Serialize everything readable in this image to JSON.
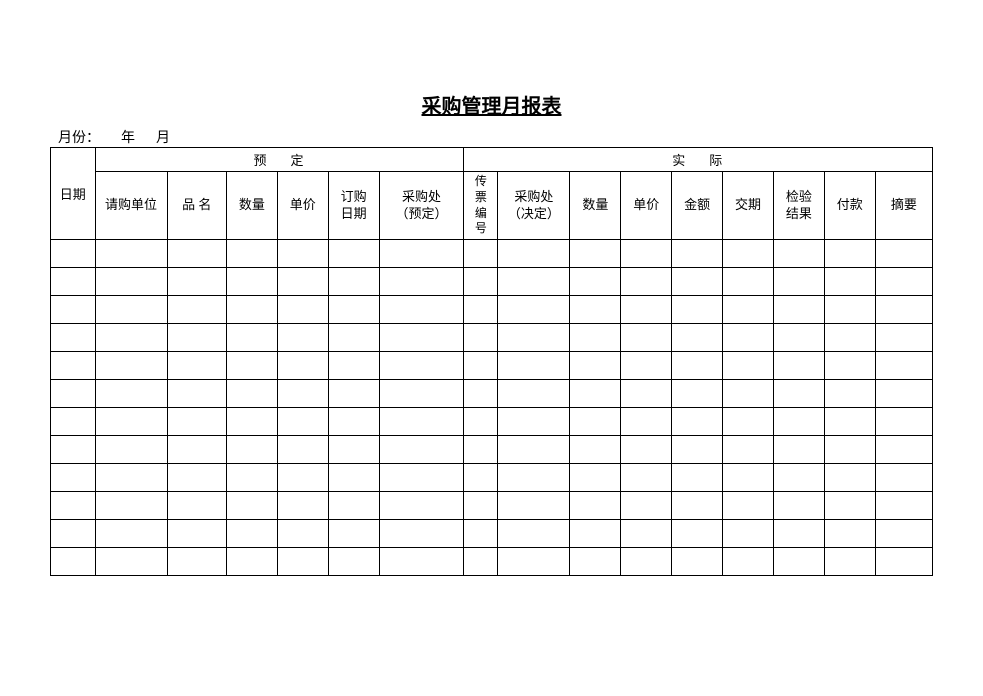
{
  "title": "采购管理月报表",
  "month_label_prefix": "月份：",
  "month_year_char": "年",
  "month_month_char": "月",
  "headers": {
    "date": "日期",
    "group_plan": "预定",
    "group_actual": "实际",
    "request_unit": "请购单位",
    "item_name": "品 名",
    "quantity": "数量",
    "unit_price": "单价",
    "order_date": "订购\n日期",
    "purchase_plan": "采购处\n（预定）",
    "ticket_no": "传\n票\n编\n号",
    "purchase_decide": "采购处\n（决定）",
    "quantity2": "数量",
    "unit_price2": "单价",
    "amount": "金额",
    "delivery": "交期",
    "inspection": "检验\n结果",
    "payment": "付款",
    "summary": "摘要"
  },
  "rows": [
    [
      "",
      "",
      "",
      "",
      "",
      "",
      "",
      "",
      "",
      "",
      "",
      "",
      "",
      "",
      "",
      ""
    ],
    [
      "",
      "",
      "",
      "",
      "",
      "",
      "",
      "",
      "",
      "",
      "",
      "",
      "",
      "",
      "",
      ""
    ],
    [
      "",
      "",
      "",
      "",
      "",
      "",
      "",
      "",
      "",
      "",
      "",
      "",
      "",
      "",
      "",
      ""
    ],
    [
      "",
      "",
      "",
      "",
      "",
      "",
      "",
      "",
      "",
      "",
      "",
      "",
      "",
      "",
      "",
      ""
    ],
    [
      "",
      "",
      "",
      "",
      "",
      "",
      "",
      "",
      "",
      "",
      "",
      "",
      "",
      "",
      "",
      ""
    ],
    [
      "",
      "",
      "",
      "",
      "",
      "",
      "",
      "",
      "",
      "",
      "",
      "",
      "",
      "",
      "",
      ""
    ],
    [
      "",
      "",
      "",
      "",
      "",
      "",
      "",
      "",
      "",
      "",
      "",
      "",
      "",
      "",
      "",
      ""
    ],
    [
      "",
      "",
      "",
      "",
      "",
      "",
      "",
      "",
      "",
      "",
      "",
      "",
      "",
      "",
      "",
      ""
    ],
    [
      "",
      "",
      "",
      "",
      "",
      "",
      "",
      "",
      "",
      "",
      "",
      "",
      "",
      "",
      "",
      ""
    ],
    [
      "",
      "",
      "",
      "",
      "",
      "",
      "",
      "",
      "",
      "",
      "",
      "",
      "",
      "",
      "",
      ""
    ],
    [
      "",
      "",
      "",
      "",
      "",
      "",
      "",
      "",
      "",
      "",
      "",
      "",
      "",
      "",
      "",
      ""
    ],
    [
      "",
      "",
      "",
      "",
      "",
      "",
      "",
      "",
      "",
      "",
      "",
      "",
      "",
      "",
      "",
      ""
    ]
  ]
}
